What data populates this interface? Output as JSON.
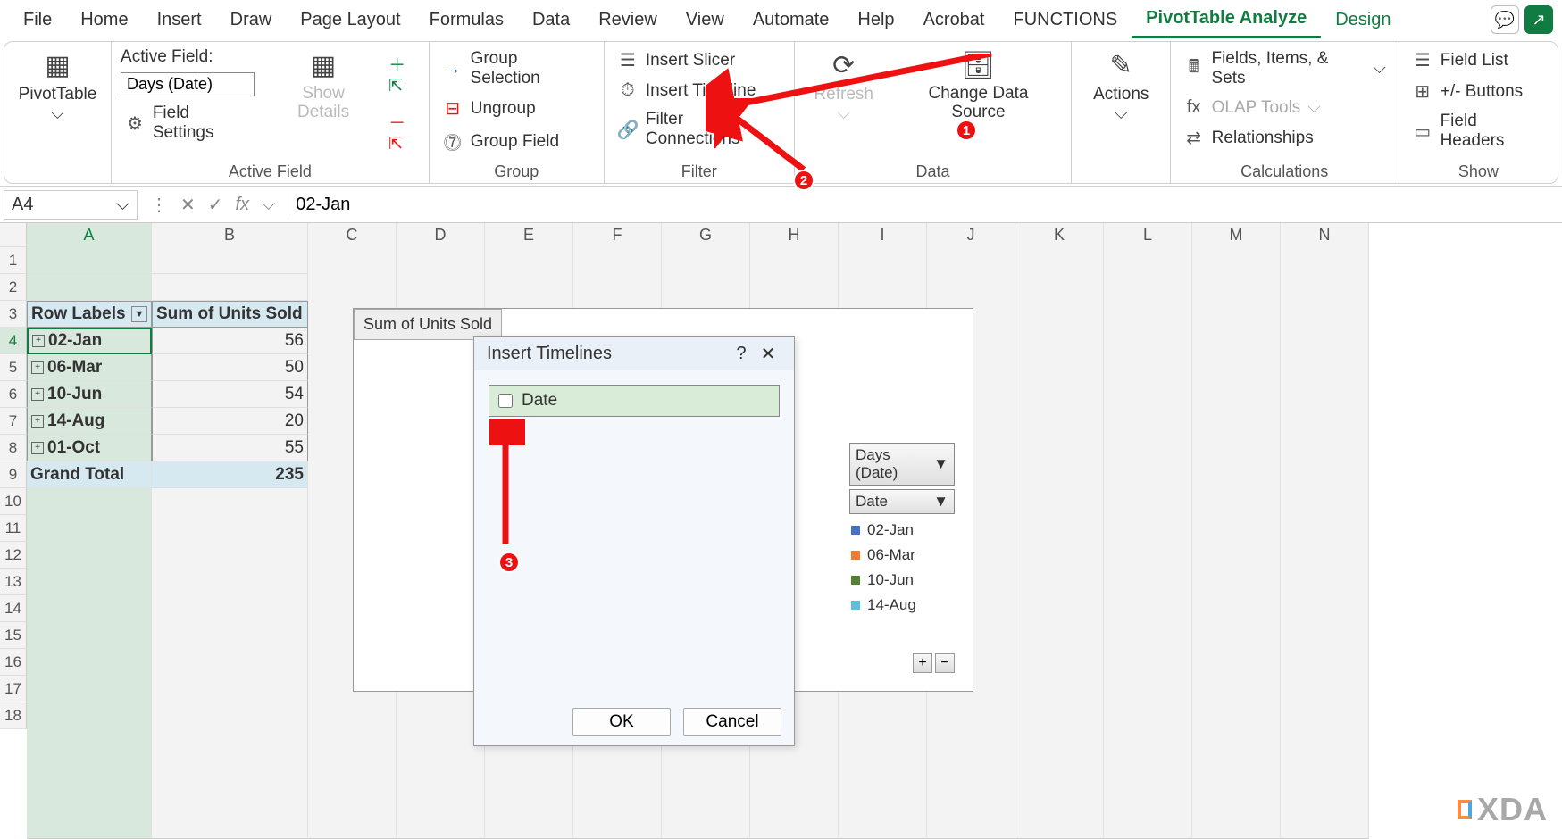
{
  "tabs": [
    "File",
    "Home",
    "Insert",
    "Draw",
    "Page Layout",
    "Formulas",
    "Data",
    "Review",
    "View",
    "Automate",
    "Help",
    "Acrobat",
    "FUNCTIONS",
    "PivotTable Analyze",
    "Design"
  ],
  "active_tab_index": 13,
  "ribbon": {
    "pivottable": {
      "label": "PivotTable"
    },
    "active_field": {
      "group_label": "Active Field",
      "caption": "Active Field:",
      "value": "Days (Date)",
      "settings": "Field Settings",
      "show_details": "Show Details"
    },
    "group": {
      "group_label": "Group",
      "selection": "Group Selection",
      "ungroup": "Ungroup",
      "field": "Group Field"
    },
    "filter": {
      "group_label": "Filter",
      "slicer": "Insert Slicer",
      "timeline": "Insert Timeline",
      "connections": "Filter Connections"
    },
    "data": {
      "group_label": "Data",
      "refresh": "Refresh",
      "change": "Change Data Source"
    },
    "actions": {
      "group_label": "",
      "label": "Actions"
    },
    "calculations": {
      "group_label": "Calculations",
      "fields": "Fields, Items, & Sets",
      "olap": "OLAP Tools",
      "rel": "Relationships"
    },
    "show": {
      "group_label": "Show",
      "fieldlist": "Field List",
      "buttons": "+/- Buttons",
      "headers": "Field Headers"
    }
  },
  "formula_bar": {
    "name_box": "A4",
    "formula": "02-Jan"
  },
  "columns": [
    "A",
    "B",
    "C",
    "D",
    "E",
    "F",
    "G",
    "H",
    "I",
    "J",
    "K",
    "L",
    "M",
    "N"
  ],
  "pivot": {
    "header_row": "Row Labels",
    "header_val": "Sum of Units Sold",
    "rows": [
      {
        "date": "02-Jan",
        "v": "56"
      },
      {
        "date": "06-Mar",
        "v": "50"
      },
      {
        "date": "10-Jun",
        "v": "54"
      },
      {
        "date": "14-Aug",
        "v": "20"
      },
      {
        "date": "01-Oct",
        "v": "55"
      }
    ],
    "total_label": "Grand Total",
    "total_value": "235"
  },
  "chart": {
    "title": "Sum of Units Sold",
    "filter1": "Days (Date)",
    "filter2": "Date",
    "legend": [
      {
        "c": "#4472c4",
        "t": "02-Jan"
      },
      {
        "c": "#ed7d31",
        "t": "06-Mar"
      },
      {
        "c": "#548235",
        "t": "10-Jun"
      },
      {
        "c": "#5bc0de",
        "t": "14-Aug"
      }
    ]
  },
  "dialog": {
    "title": "Insert Timelines",
    "item": "Date",
    "ok": "OK",
    "cancel": "Cancel"
  },
  "annotations": {
    "b1": "1",
    "b2": "2",
    "b3": "3"
  },
  "watermark": "XDA"
}
